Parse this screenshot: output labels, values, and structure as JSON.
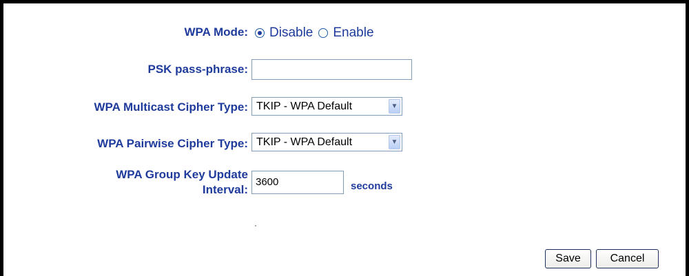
{
  "wpa_mode": {
    "label": "WPA Mode:",
    "options": [
      "Disable",
      "Enable"
    ],
    "selected": "Disable"
  },
  "psk": {
    "label": "PSK pass-phrase:",
    "value": ""
  },
  "multicast": {
    "label": "WPA Multicast Cipher Type:",
    "selected": "TKIP - WPA Default"
  },
  "pairwise": {
    "label": "WPA Pairwise Cipher Type:",
    "selected": "TKIP - WPA Default"
  },
  "group_key": {
    "label_line1": "WPA Group Key Update",
    "label_line2": "Interval:",
    "value": "3600",
    "unit": "seconds"
  },
  "buttons": {
    "save": "Save",
    "cancel": "Cancel"
  },
  "icons": {
    "dropdown": "chevron-down-icon",
    "radio": "radio-icon"
  },
  "colors": {
    "label_text": "#1f3b9c",
    "input_border": "#7f9db9"
  }
}
